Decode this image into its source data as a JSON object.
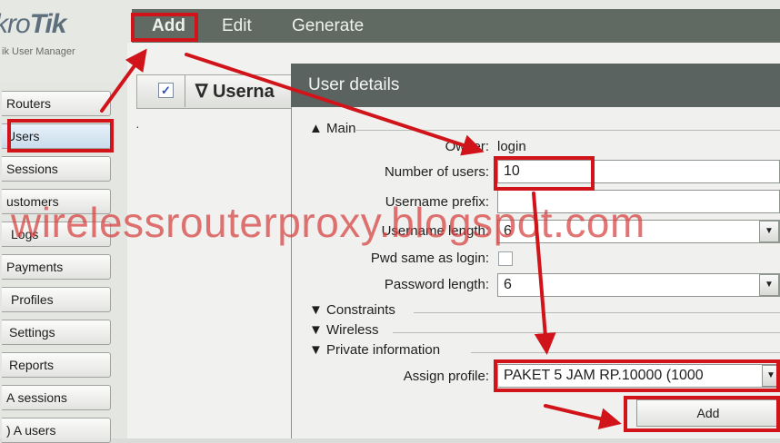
{
  "brand": {
    "logo_light": "kro",
    "logo_bold": "Tik",
    "subtitle": "ik User Manager"
  },
  "menu": {
    "add": "Add",
    "edit": "Edit",
    "generate": "Generate"
  },
  "sidebar": {
    "items": [
      {
        "label": "Routers"
      },
      {
        "label": "Users"
      },
      {
        "label": "Sessions"
      },
      {
        "label": "ustomers"
      },
      {
        "label": "Logs"
      },
      {
        "label": "Payments"
      },
      {
        "label": "Profiles"
      },
      {
        "label": "Settings"
      },
      {
        "label": "Reports"
      },
      {
        "label": "A sessions"
      },
      {
        "label": ") A users"
      }
    ]
  },
  "table": {
    "check_glyph": "✓",
    "sort_glyph": "∇",
    "column_label": "Userna",
    "row_marker": "·"
  },
  "dialog": {
    "title": "User details",
    "sections": {
      "main": "Main",
      "constraints": "Constraints",
      "wireless": "Wireless",
      "private": "Private information"
    },
    "fields": {
      "owner_label": "Owner:",
      "owner_value": "login",
      "number_label": "Number of users:",
      "number_value": "10",
      "prefix_label": "Username prefix:",
      "prefix_value": "",
      "length_label": "Username length:",
      "length_value": "6",
      "pwd_same_label": "Pwd same as login:",
      "pwd_len_label": "Password length:",
      "pwd_len_value": "6",
      "profile_label": "Assign profile:",
      "profile_value": "PAKET 5 JAM RP.10000 (1000"
    },
    "add_button": "Add"
  },
  "watermark": "wirelessrouterproxy.blogspot.com",
  "colors": {
    "highlight": "#d0141a",
    "menubar": "#606a63",
    "dialog_title": "#5a6360"
  }
}
